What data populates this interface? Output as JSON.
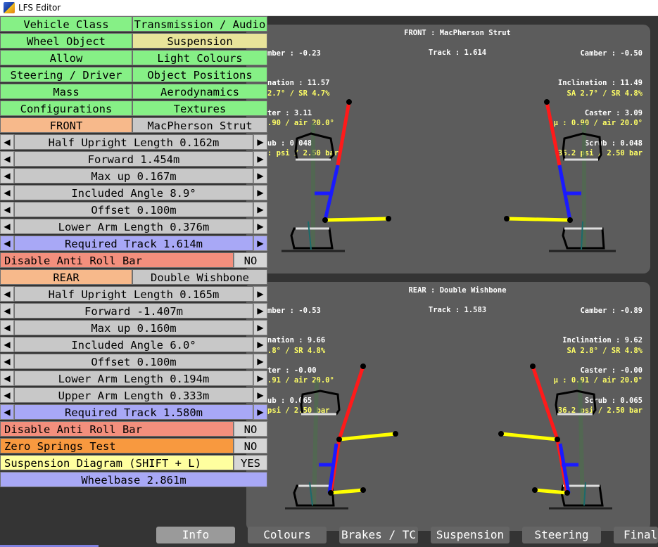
{
  "window": {
    "title": "LFS Editor"
  },
  "menu": {
    "top_grid": [
      [
        "Vehicle Class",
        "Transmission / Audio"
      ],
      [
        "Wheel Object",
        "Suspension"
      ],
      [
        "Allow",
        "Light Colours"
      ],
      [
        "Steering / Driver",
        "Object Positions"
      ],
      [
        "Mass",
        "Aerodynamics"
      ],
      [
        "Configurations",
        "Textures"
      ]
    ],
    "front": {
      "label": "FRONT",
      "type": "MacPherson Strut",
      "params": [
        "Half Upright Length 0.162m",
        "Forward 1.454m",
        "Max up 0.167m",
        "Included Angle 8.9°",
        "Offset 0.100m",
        "Lower Arm Length 0.376m"
      ],
      "required_track": "Required Track 1.614m",
      "anti_roll": {
        "label": "Disable Anti Roll Bar",
        "value": "NO"
      }
    },
    "rear": {
      "label": "REAR",
      "type": "Double Wishbone",
      "params": [
        "Half Upright Length 0.165m",
        "Forward -1.407m",
        "Max up 0.160m",
        "Included Angle 6.0°",
        "Offset 0.100m",
        "Lower Arm Length 0.194m",
        "Upper Arm Length 0.333m"
      ],
      "required_track": "Required Track 1.580m",
      "anti_roll": {
        "label": "Disable Anti Roll Bar",
        "value": "NO"
      }
    },
    "zero_springs": {
      "label": "Zero Springs Test",
      "value": "NO"
    },
    "diagram": {
      "label": "Suspension Diagram (SHIFT + L)",
      "value": "YES"
    },
    "wheelbase": "Wheelbase 2.861m",
    "arrow_left": "◀",
    "arrow_right": "▶"
  },
  "front_panel": {
    "title": "FRONT : MacPherson Strut",
    "track": "Track : 1.614",
    "left_white": [
      "mber : -0.23",
      "nation : 11.57",
      "ter : 3.11",
      "ub : 0.048"
    ],
    "left_yellow": [
      "2.7° / SR 4.7%",
      ".90 / air 20.0°",
      ": psi / 2.50 bar"
    ],
    "right_white": [
      "Camber : -0.50",
      "Inclination : 11.49",
      "Caster : 3.09",
      "Scrub : 0.048"
    ],
    "right_yellow": [
      "SA 2.7° / SR 4.8%",
      "μ : 0.90 / air 20.0°",
      "36.2 psi / 2.50 bar"
    ]
  },
  "rear_panel": {
    "title": "REAR : Double Wishbone",
    "track": "Track : 1.583",
    "left_white": [
      "mber : -0.53",
      "nation : 9.66",
      "ter : -0.00",
      "ub : 0.065"
    ],
    "left_yellow": [
      ".8° / SR 4.8%",
      ".91 / air 20.0°",
      "psi / 2.50 bar"
    ],
    "right_white": [
      "Camber : -0.89",
      "Inclination : 9.62",
      "Caster : -0.00",
      "Scrub : 0.065"
    ],
    "right_yellow": [
      "SA 2.8° / SR 4.8%",
      "μ : 0.91 / air 20.0°",
      "36.2 psi / 2.50 bar"
    ]
  },
  "tabs": [
    "Info",
    "Colours",
    "Brakes / TC",
    "Suspension",
    "Steering",
    "Final D"
  ],
  "colors": {
    "strut": "#ff1a1a",
    "upright": "#1a1aff",
    "arm": "#ffff00",
    "joint": "#000000"
  }
}
